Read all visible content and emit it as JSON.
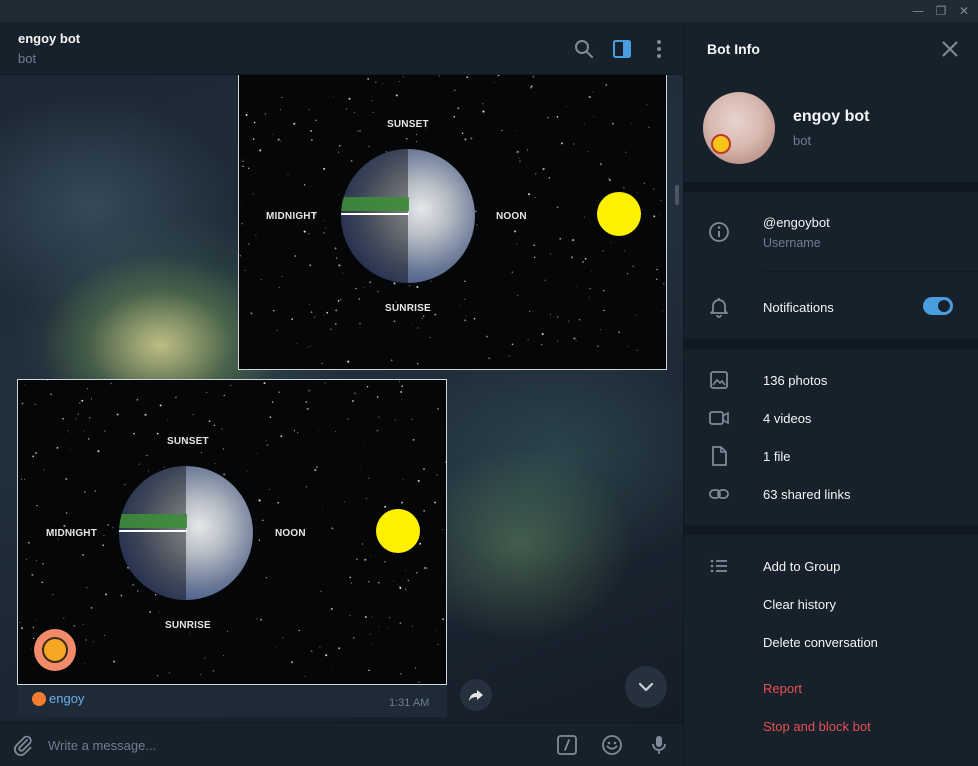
{
  "window": {
    "minimize_glyph": "—",
    "maximize_glyph": "❐",
    "close_glyph": "✕"
  },
  "chat": {
    "title": "engoy bot",
    "subtitle": "bot",
    "header_icons": [
      "search-icon",
      "sidebar-panel-icon",
      "more-vertical-icon"
    ]
  },
  "messages": {
    "photo_labels": {
      "top": "SUNSET",
      "left": "MIDNIGHT",
      "right": "NOON",
      "bottom": "SUNRISE"
    },
    "caption": {
      "emoji": "🍊",
      "name": "engoy",
      "time": "1:31 AM"
    }
  },
  "composer": {
    "placeholder": "Write a message...",
    "icons": [
      "paperclip-icon",
      "slash-command-icon",
      "emoji-icon",
      "microphone-icon"
    ]
  },
  "info_panel": {
    "title": "Bot Info",
    "profile": {
      "name": "engoy bot",
      "subtitle": "bot"
    },
    "username": {
      "value": "@engoybot",
      "label": "Username"
    },
    "notifications": {
      "label": "Notifications",
      "enabled": true
    },
    "media": [
      {
        "label": "136 photos",
        "icon": "photo-icon"
      },
      {
        "label": "4 videos",
        "icon": "video-icon"
      },
      {
        "label": "1 file",
        "icon": "file-icon"
      },
      {
        "label": "63 shared links",
        "icon": "link-icon"
      }
    ],
    "actions": {
      "add_to_group": "Add to Group",
      "clear_history": "Clear history",
      "delete_conversation": "Delete conversation",
      "report": "Report",
      "stop_and_block": "Stop and block bot"
    }
  },
  "colors": {
    "accent": "#4a9ee0",
    "danger": "#e85050",
    "panel_bg": "#17212b",
    "muted_text": "#6d7f8f"
  }
}
